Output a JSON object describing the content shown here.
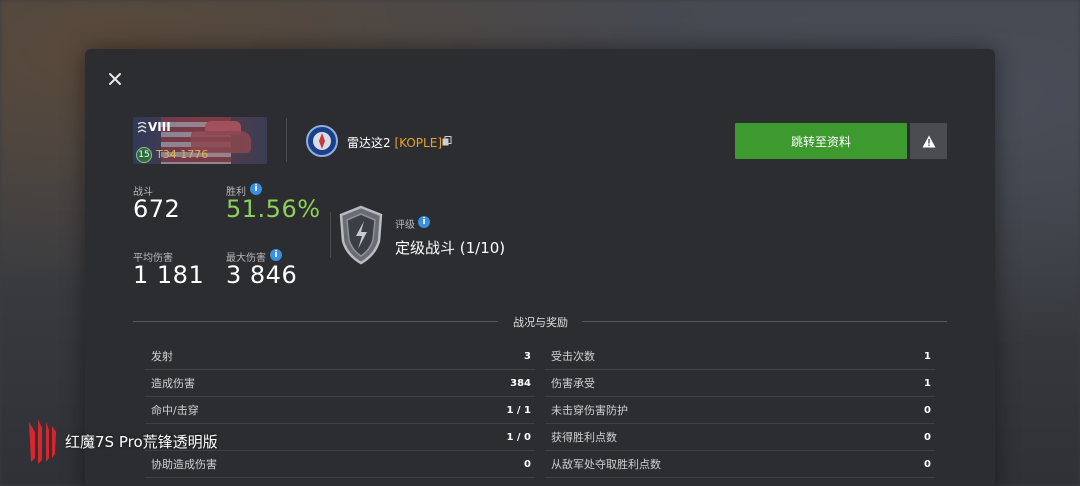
{
  "vehicle": {
    "tier": "VIII",
    "level": "15",
    "name": "T34 1776"
  },
  "player": {
    "name": "雷达这2",
    "clan_tag": "[KOPLE]"
  },
  "actions": {
    "profile_button": "跳转至资料"
  },
  "stats": {
    "battles": {
      "label": "战斗",
      "value": "672"
    },
    "win_rate": {
      "label": "胜利",
      "value": "51.56%"
    },
    "avg_damage": {
      "label": "平均伤害",
      "value": "1 181"
    },
    "max_damage": {
      "label": "最大伤害",
      "value": "3 846"
    }
  },
  "rating": {
    "label": "评级",
    "value": "定级战斗 (1/10)"
  },
  "section": {
    "title": "战况与奖励"
  },
  "battle_table": {
    "left": [
      {
        "label": "发射",
        "value": "3"
      },
      {
        "label": "造成伤害",
        "value": "384"
      },
      {
        "label": "命中/击穿",
        "value": "1 / 1"
      },
      {
        "label": "",
        "value": "1 / 0"
      },
      {
        "label": "协助造成伤害",
        "value": "0"
      }
    ],
    "right": [
      {
        "label": "受击次数",
        "value": "1"
      },
      {
        "label": "伤害承受",
        "value": "1"
      },
      {
        "label": "未击穿伤害防护",
        "value": "0"
      },
      {
        "label": "获得胜利点数",
        "value": "0"
      },
      {
        "label": "从敌军处夺取胜利点数",
        "value": "0"
      }
    ]
  },
  "watermark": {
    "text": "红魔7S Pro荒锋透明版"
  },
  "colors": {
    "accent_green": "#3d9a2e",
    "win_rate_green": "#8ed05a",
    "clan_orange": "#e8a030",
    "info_blue": "#3a8fe0",
    "dialog_bg": "#2b2d31"
  }
}
